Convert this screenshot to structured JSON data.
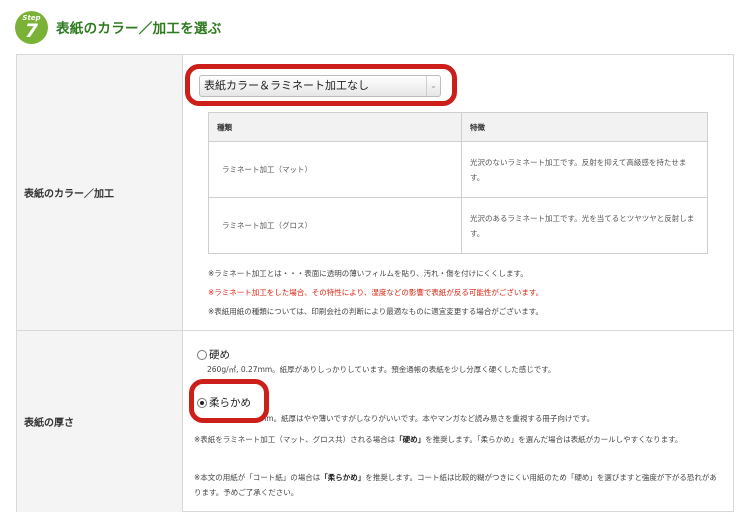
{
  "step": {
    "label": "Step",
    "number": "7",
    "title": "表紙のカラー／加工を選ぶ"
  },
  "cover_finish": {
    "row_label": "表紙のカラー／加工",
    "select": {
      "selected": "表紙カラー＆ラミネート加工なし",
      "arrow": "⌄"
    },
    "table": {
      "headers": [
        "種類",
        "特徴"
      ],
      "rows": [
        {
          "type": "ラミネート加工（マット）",
          "desc": "光沢のないラミネート加工です。反射を抑えて高級感を持たせます。"
        },
        {
          "type": "ラミネート加工（グロス）",
          "desc": "光沢のあるラミネート加工です。光を当てるとツヤツヤと反射します。"
        }
      ]
    },
    "notes": [
      "※ラミネート加工とは・・・表面に透明の薄いフィルムを貼り、汚れ・傷を付けにくくします。",
      "※ラミネート加工をした場合、その特性により、湿度などの影響で表紙が反る可能性がございます。",
      "※表紙用紙の種類については、印刷会社の判断により最適なものに適宜変更する場合がございます。"
    ]
  },
  "thickness": {
    "row_label": "表紙の厚さ",
    "options": [
      {
        "label": "硬め",
        "checked": false,
        "desc": "260g/㎡, 0.27mm。紙厚がありしっかりしています。預金通帳の表紙を少し分厚く硬くした感じです。"
      },
      {
        "label": "柔らかめ",
        "checked": true,
        "desc_visible": "mm。紙厚はやや薄いですがしなりがいいです。本やマンガなど読み易さを重視する冊子向けです。"
      }
    ],
    "note1": {
      "pre": "※表紙をラミネート加工（マット、グロス共）される場合は",
      "bold": "「硬め」",
      "post": "を推奨します。「柔らかめ」を選んだ場合は表紙がカールしやすくなります。"
    },
    "note2": {
      "pre": "※本文の用紙が「コート紙」の場合は",
      "bold": "「柔らかめ」",
      "post": "を推奨します。コート紙は比較的糊がつきにくい用紙のため「硬め」を選びますと強度が下がる恐れがあります。予めご了承ください。"
    }
  },
  "colors": {
    "accent_green": "#7ab237",
    "title_green": "#2e7a1f",
    "highlight_red": "#cc1f1a",
    "warning_red": "#d9230f"
  }
}
